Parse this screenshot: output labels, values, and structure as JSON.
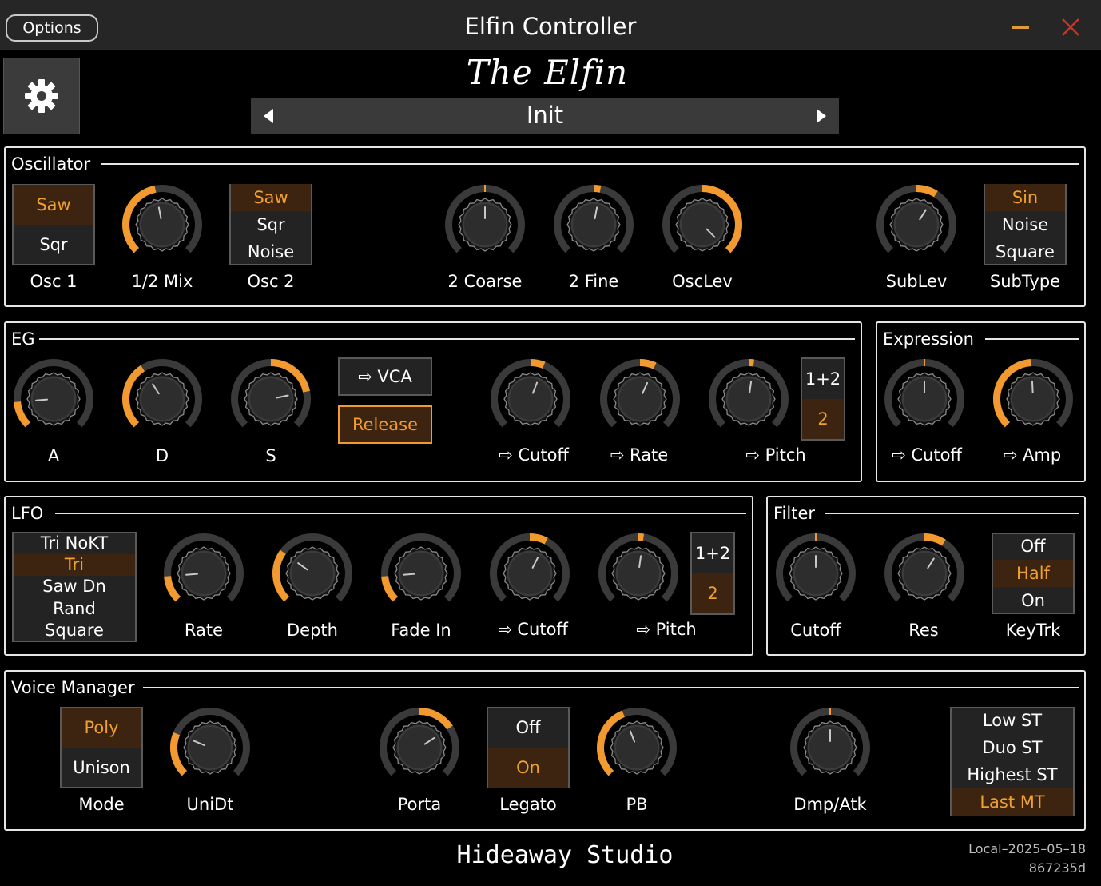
{
  "window": {
    "title": "Elfin Controller",
    "options_label": "Options"
  },
  "colors": {
    "accent": "#f29a30",
    "knob_track": "#3a3a3a",
    "selected_bg": "#3c2410",
    "panel_border": "#e6e6e6",
    "background": "#000000"
  },
  "header": {
    "brand": "The Elfin",
    "preset": "Init",
    "settings_icon": "gear-icon"
  },
  "oscillator": {
    "title": "Oscillator",
    "osc1": {
      "label": "Osc 1",
      "options": [
        "Saw",
        "Sqr"
      ],
      "selected": 0
    },
    "mix": {
      "label": "1/2 Mix",
      "value": 0.46
    },
    "osc2": {
      "label": "Osc 2",
      "options": [
        "Saw",
        "Sqr",
        "Noise"
      ],
      "selected": 0
    },
    "coarse": {
      "label": "2 Coarse",
      "value": 0.5
    },
    "fine": {
      "label": "2 Fine",
      "value": 0.54
    },
    "osclev": {
      "label": "OscLev",
      "value": 1.0
    },
    "sublev": {
      "label": "SubLev",
      "value": 0.62
    },
    "subtype": {
      "label": "SubType",
      "options": [
        "Sin",
        "Noise",
        "Square"
      ],
      "selected": 0
    }
  },
  "eg": {
    "title": "EG",
    "a": {
      "label": "A",
      "value": 0.15
    },
    "d": {
      "label": "D",
      "value": 0.38
    },
    "s": {
      "label": "S",
      "value": 0.79
    },
    "vca_label": "⇨ VCA",
    "release_label": "Release",
    "release_on": true,
    "cutoff": {
      "label": "⇨ Cutoff",
      "value": 0.58
    },
    "rate": {
      "label": "⇨ Rate",
      "value": 0.59
    },
    "pitch": {
      "label": "⇨ Pitch",
      "value": 0.53
    },
    "osc_target": {
      "options": [
        "1+2",
        "2"
      ],
      "selected": 1
    }
  },
  "expression": {
    "title": "Expression",
    "cutoff": {
      "label": "⇨ Cutoff",
      "value": 0.5
    },
    "amp": {
      "label": "⇨ Amp",
      "value": 0.49
    }
  },
  "lfo": {
    "title": "LFO",
    "wave": {
      "options": [
        "Tri NoKT",
        "Tri",
        "Saw Dn",
        "Rand",
        "Square"
      ],
      "selected": 1
    },
    "rate": {
      "label": "Rate",
      "value": 0.15
    },
    "depth": {
      "label": "Depth",
      "value": 0.3
    },
    "fadein": {
      "label": "Fade In",
      "value": 0.15
    },
    "cutoff": {
      "label": "⇨ Cutoff",
      "value": 0.6
    },
    "pitch": {
      "label": "⇨ Pitch",
      "value": 0.53
    },
    "osc_target": {
      "options": [
        "1+2",
        "2"
      ],
      "selected": 1
    }
  },
  "filter": {
    "title": "Filter",
    "cutoff": {
      "label": "Cutoff",
      "value": 0.5
    },
    "res": {
      "label": "Res",
      "value": 0.62
    },
    "keytrk": {
      "label": "KeyTrk",
      "options": [
        "Off",
        "Half",
        "On"
      ],
      "selected": 1
    }
  },
  "voice": {
    "title": "Voice Manager",
    "mode": {
      "label": "Mode",
      "options": [
        "Poly",
        "Unison"
      ],
      "selected": 0
    },
    "unidt": {
      "label": "UniDt",
      "value": 0.25
    },
    "porta": {
      "label": "Porta",
      "value": 0.71
    },
    "legato": {
      "label": "Legato",
      "options": [
        "Off",
        "On"
      ],
      "selected": 1
    },
    "pb": {
      "label": "PB",
      "value": 0.42
    },
    "dmpatk": {
      "label": "Dmp/Atk",
      "value": 0.5
    },
    "priority": {
      "options": [
        "Low ST",
        "Duo ST",
        "Highest ST",
        "Last MT"
      ],
      "selected": 3
    }
  },
  "footer": {
    "studio": "Hideaway Studio",
    "build_date": "Local–2025–05–18",
    "build_hash": "867235d"
  }
}
